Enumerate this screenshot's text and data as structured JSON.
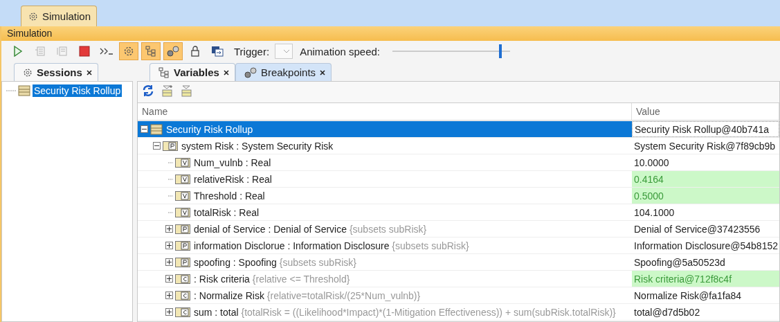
{
  "window": {
    "tab": {
      "label": "Simulation",
      "selected": true
    }
  },
  "panel_title": "Simulation",
  "toolbar": {
    "buttons": [
      {
        "kind": "run",
        "disabled": false,
        "on": false
      },
      {
        "kind": "step-into",
        "disabled": true,
        "on": false
      },
      {
        "kind": "step-out",
        "disabled": true,
        "on": false
      },
      {
        "kind": "stop",
        "disabled": false,
        "on": false
      },
      {
        "kind": "console",
        "disabled": false,
        "on": false
      },
      {
        "kind": "settings",
        "disabled": false,
        "on": true
      },
      {
        "kind": "tree",
        "disabled": false,
        "on": true
      },
      {
        "kind": "breakpoints",
        "disabled": false,
        "on": true
      },
      {
        "kind": "lock",
        "disabled": false,
        "on": false
      },
      {
        "kind": "export",
        "disabled": false,
        "on": false
      }
    ],
    "trigger_label": "Trigger:",
    "speed_label": "Animation speed:",
    "speed": {
      "level": 0.92
    }
  },
  "sessions": {
    "tab": {
      "label": "Sessions",
      "selected": true
    },
    "items": [
      {
        "label": "Security Risk Rollup",
        "selected": true
      }
    ]
  },
  "tabs": [
    {
      "label": "Variables",
      "kind": "tree",
      "selected": true
    },
    {
      "label": "Breakpoints",
      "kind": "breakpoints",
      "selected": false
    }
  ],
  "table": {
    "columns": [
      "Name",
      "Value"
    ],
    "rows": [
      {
        "kind": "block",
        "name": "Security Risk Rollup",
        "value": "Security Risk Rollup@40b741a",
        "expanded": true,
        "selected": true,
        "changed": false,
        "children": [
          {
            "kind": "P",
            "name": "system Risk : System Security Risk",
            "value": "System Security Risk@7f89cb9b",
            "expanded": true,
            "selected": false,
            "changed": false,
            "children": [
              {
                "kind": "V",
                "name": "Num_vulnb : Real",
                "value": "10.0000",
                "selected": false,
                "changed": false
              },
              {
                "kind": "V",
                "name": "relativeRisk : Real",
                "value": "0.4164",
                "selected": false,
                "changed": true
              },
              {
                "kind": "V",
                "name": "Threshold : Real",
                "value": "0.5000",
                "selected": false,
                "changed": true
              },
              {
                "kind": "V",
                "name": "totalRisk : Real",
                "value": "104.1000",
                "selected": false,
                "changed": false
              },
              {
                "kind": "P",
                "name": "denial of Service : Denial of Service",
                "note": "{subsets subRisk}",
                "value": "Denial of Service@37423556",
                "expanded": false,
                "selected": false,
                "changed": false
              },
              {
                "kind": "P",
                "name": "information Disclorue : Information Disclosure",
                "note": "{subsets subRisk}",
                "value": "Information Disclosure@54b8152",
                "expanded": false,
                "selected": false,
                "changed": false
              },
              {
                "kind": "P",
                "name": "spoofing : Spoofing",
                "note": "{subsets subRisk}",
                "value": "Spoofing@5a50523d",
                "expanded": false,
                "selected": false,
                "changed": false
              },
              {
                "kind": "C",
                "name": " : Risk criteria",
                "note": "{relative <= Threshold}",
                "value": "Risk criteria@712f8c4f",
                "expanded": false,
                "selected": false,
                "changed": true
              },
              {
                "kind": "C",
                "name": " : Normalize Risk",
                "note": "{relative=totalRisk/(25*Num_vulnb)}",
                "value": "Normalize Risk@fa1fa84",
                "expanded": false,
                "selected": false,
                "changed": false
              },
              {
                "kind": "C",
                "name": "sum : total",
                "note": "{totalRisk = ((Likelihood*Impact)*(1-Mitigation Effectiveness)) + sum(subRisk.totalRisk)}",
                "value": "total@d7d5b02",
                "expanded": false,
                "selected": false,
                "changed": false
              }
            ]
          }
        ]
      }
    ]
  }
}
